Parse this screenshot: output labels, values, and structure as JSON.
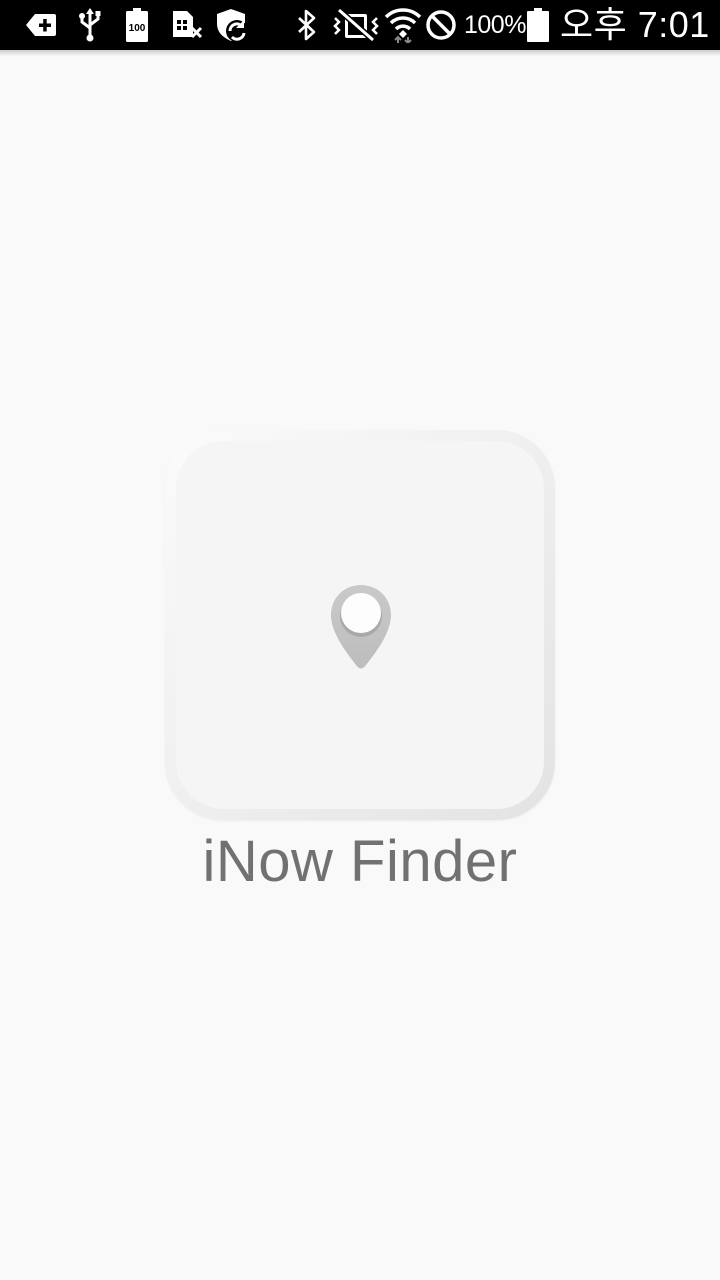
{
  "status_bar": {
    "icons_left": [
      "back-badge-icon",
      "usb-icon",
      "battery-full-100-icon",
      "sim-card-off-icon",
      "shield-sync-icon"
    ],
    "icons_right": [
      "bluetooth-icon",
      "vibrate-off-icon",
      "wifi-icon",
      "do-not-disturb-icon",
      "battery-icon"
    ],
    "battery_percent": "100%",
    "time": "오후 7:01"
  },
  "splash": {
    "app_icon": "location-pin-icon",
    "app_name": "iNow Finder"
  },
  "colors": {
    "background": "#f9f9f9",
    "status_bar": "#000000",
    "app_name_text": "#717171",
    "pin": "#c4c4c4"
  }
}
